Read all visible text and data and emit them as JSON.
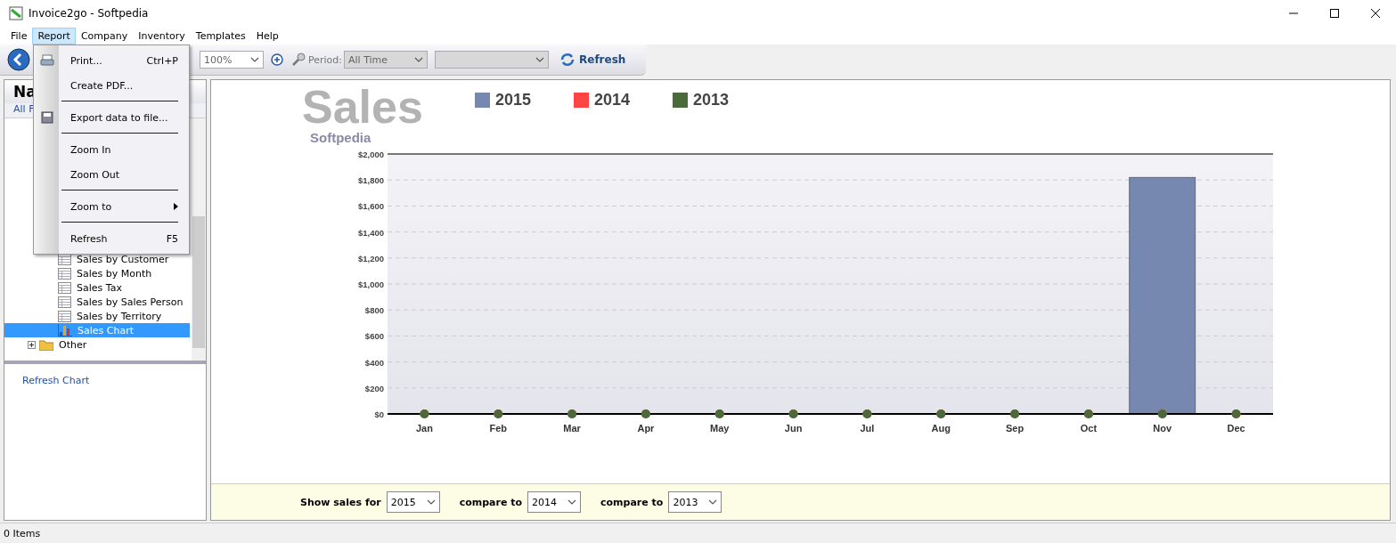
{
  "window": {
    "title": "Invoice2go - Softpedia"
  },
  "menubar": [
    {
      "label": "File",
      "selected": false
    },
    {
      "label": "Report",
      "selected": true
    },
    {
      "label": "Company",
      "selected": false
    },
    {
      "label": "Inventory",
      "selected": false
    },
    {
      "label": "Templates",
      "selected": false
    },
    {
      "label": "Help",
      "selected": false
    }
  ],
  "report_menu": [
    {
      "kind": "item",
      "label": "Print...",
      "shortcut": "Ctrl+P"
    },
    {
      "kind": "item",
      "label": "Create PDF..."
    },
    {
      "kind": "separator"
    },
    {
      "kind": "item",
      "label": "Export data to file..."
    },
    {
      "kind": "separator"
    },
    {
      "kind": "item",
      "label": "Zoom In"
    },
    {
      "kind": "item",
      "label": "Zoom Out"
    },
    {
      "kind": "separator"
    },
    {
      "kind": "submenu",
      "label": "Zoom to"
    },
    {
      "kind": "separator"
    },
    {
      "kind": "item",
      "label": "Refresh",
      "shortcut": "F5"
    }
  ],
  "toolbar": {
    "zoom": "100%",
    "period_label": "Period:",
    "period": "All Time",
    "refresh": "Refresh"
  },
  "sidebar": {
    "header": "Na",
    "filter": "All F",
    "tree": [
      {
        "label": "Sales by Customer",
        "kind": "report",
        "selected": false
      },
      {
        "label": "Sales by Month",
        "kind": "report",
        "selected": false
      },
      {
        "label": "Sales Tax",
        "kind": "report",
        "selected": false
      },
      {
        "label": "Sales by Sales Person",
        "kind": "report",
        "selected": false
      },
      {
        "label": "Sales by Territory",
        "kind": "report",
        "selected": false
      },
      {
        "label": "Sales Chart",
        "kind": "chart",
        "selected": true
      },
      {
        "label": "Other",
        "kind": "folder",
        "selected": false,
        "expanded": false
      }
    ],
    "link": "Refresh Chart"
  },
  "report": {
    "title": "Sales",
    "subtitle": "Softpedia",
    "chart_data": {
      "type": "bar",
      "categories": [
        "Jan",
        "Feb",
        "Mar",
        "Apr",
        "May",
        "Jun",
        "Jul",
        "Aug",
        "Sep",
        "Oct",
        "Nov",
        "Dec"
      ],
      "series": [
        {
          "name": "2015",
          "color": "#7788b0",
          "values": [
            0,
            0,
            0,
            0,
            0,
            0,
            0,
            0,
            0,
            0,
            1820,
            0
          ]
        },
        {
          "name": "2014",
          "color": "#ff4444",
          "values": [
            0,
            0,
            0,
            0,
            0,
            0,
            0,
            0,
            0,
            0,
            0,
            0
          ]
        },
        {
          "name": "2013",
          "color": "#4a6a3a",
          "values": [
            0,
            0,
            0,
            0,
            0,
            0,
            0,
            0,
            0,
            0,
            0,
            0
          ]
        }
      ],
      "grid": true,
      "ylim": [
        0,
        2000
      ],
      "yticks": [
        {
          "value": 0,
          "label": "$0"
        },
        {
          "value": 200,
          "label": "$200"
        },
        {
          "value": 400,
          "label": "$400"
        },
        {
          "value": 600,
          "label": "$600"
        },
        {
          "value": 800,
          "label": "$800"
        },
        {
          "value": 1000,
          "label": "$1,000"
        },
        {
          "value": 1200,
          "label": "$1,200"
        },
        {
          "value": 1400,
          "label": "$1,400"
        },
        {
          "value": 1600,
          "label": "$1,600"
        },
        {
          "value": 1800,
          "label": "$1,800"
        },
        {
          "value": 2000,
          "label": "$2,000"
        }
      ]
    },
    "filters": [
      {
        "label": "Show sales for",
        "value": "2015"
      },
      {
        "label": "compare to",
        "value": "2014"
      },
      {
        "label": "compare to",
        "value": "2013"
      }
    ]
  },
  "status_bar": {
    "text": "0 Items"
  }
}
